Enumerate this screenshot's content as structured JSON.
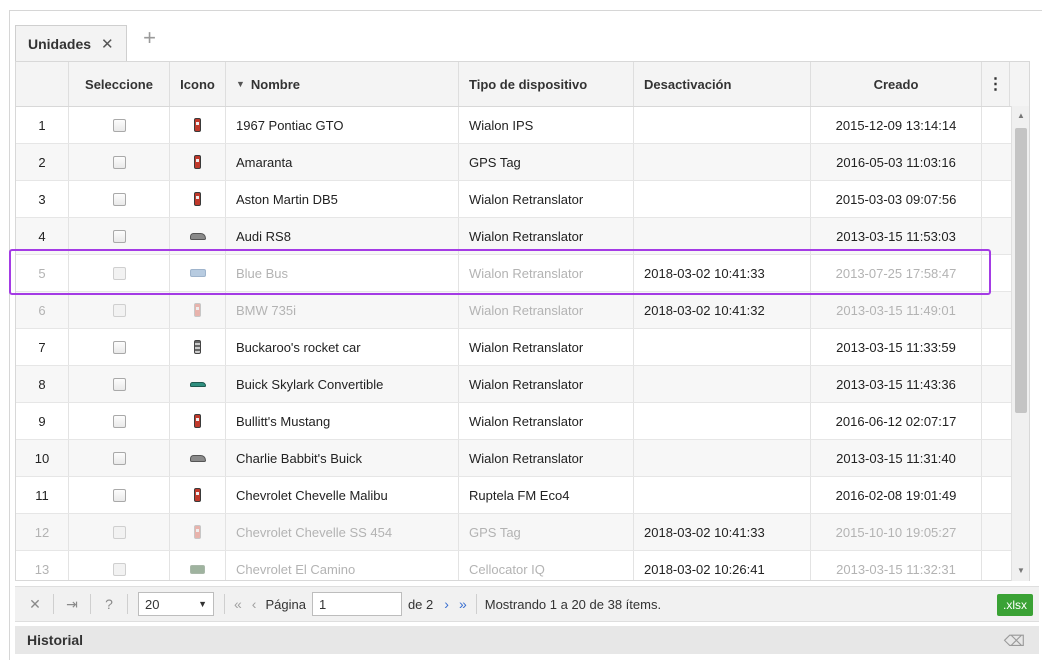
{
  "tabs": [
    {
      "label": "Unidades",
      "close": "✕"
    }
  ],
  "add_tab": "+",
  "columns": {
    "num": "",
    "select": "Seleccione",
    "icon": "Icono",
    "name_sort": "▼",
    "name": "Nombre",
    "device": "Tipo de dispositivo",
    "deactivation": "Desactivación",
    "created": "Creado",
    "menu": "⋮"
  },
  "rows": [
    {
      "n": "1",
      "icon": "red-car-icon",
      "name": "1967 Pontiac GTO",
      "device": "Wialon IPS",
      "deact": "",
      "created": "2015-12-09 13:14:14"
    },
    {
      "n": "2",
      "icon": "red-car-icon",
      "name": "Amaranta",
      "device": "GPS Tag",
      "deact": "",
      "created": "2016-05-03 11:03:16"
    },
    {
      "n": "3",
      "icon": "red-car-icon",
      "name": "Aston Martin DB5",
      "device": "Wialon Retranslator",
      "deact": "",
      "created": "2015-03-03 09:07:56"
    },
    {
      "n": "4",
      "icon": "gray-car-side-icon",
      "name": "Audi RS8",
      "device": "Wialon Retranslator",
      "deact": "",
      "created": "2013-03-15 11:53:03"
    },
    {
      "n": "5",
      "icon": "bus-icon",
      "name": "Blue Bus",
      "device": "Wialon Retranslator",
      "deact": "2018-03-02 10:41:33",
      "created": "2013-07-25 17:58:47"
    },
    {
      "n": "6",
      "icon": "red-car-icon",
      "name": "BMW 735i",
      "device": "Wialon Retranslator",
      "deact": "2018-03-02 10:41:32",
      "created": "2013-03-15 11:49:01"
    },
    {
      "n": "7",
      "icon": "rocket-car-icon",
      "name": "Buckaroo's rocket car",
      "device": "Wialon Retranslator",
      "deact": "",
      "created": "2013-03-15 11:33:59"
    },
    {
      "n": "8",
      "icon": "teal-car-side-icon",
      "name": "Buick Skylark Convertible",
      "device": "Wialon Retranslator",
      "deact": "",
      "created": "2013-03-15 11:43:36"
    },
    {
      "n": "9",
      "icon": "red-car-icon",
      "name": "Bullitt's Mustang",
      "device": "Wialon Retranslator",
      "deact": "",
      "created": "2016-06-12 02:07:17"
    },
    {
      "n": "10",
      "icon": "gray-car-side-icon",
      "name": "Charlie Babbit's Buick",
      "device": "Wialon Retranslator",
      "deact": "",
      "created": "2013-03-15 11:31:40"
    },
    {
      "n": "11",
      "icon": "red-car-icon",
      "name": "Chevrolet Chevelle Malibu",
      "device": "Ruptela FM Eco4",
      "deact": "",
      "created": "2016-02-08 19:01:49"
    },
    {
      "n": "12",
      "icon": "red-car-icon",
      "name": "Chevrolet Chevelle SS 454",
      "device": "GPS Tag",
      "deact": "2018-03-02 10:41:33",
      "created": "2015-10-10 19:05:27"
    },
    {
      "n": "13",
      "icon": "truck-icon",
      "name": "Chevrolet El Camino",
      "device": "Cellocator IQ",
      "deact": "2018-03-02 10:26:41",
      "created": "2013-03-15 11:32:31"
    }
  ],
  "pager": {
    "clear": "✕",
    "fit": "⇥",
    "help": "?",
    "page_size": "20",
    "first": "«",
    "prev": "‹",
    "page_label": "Página",
    "page_value": "1",
    "of": "de 2",
    "next": "›",
    "last": "»",
    "status": "Mostrando 1 a 20 de 38 ítems.",
    "export": ".xlsx"
  },
  "history": {
    "label": "Historial"
  },
  "colors": {
    "highlight": "#a43be5",
    "export_bg": "#3aa235",
    "link": "#3a6fd0"
  }
}
